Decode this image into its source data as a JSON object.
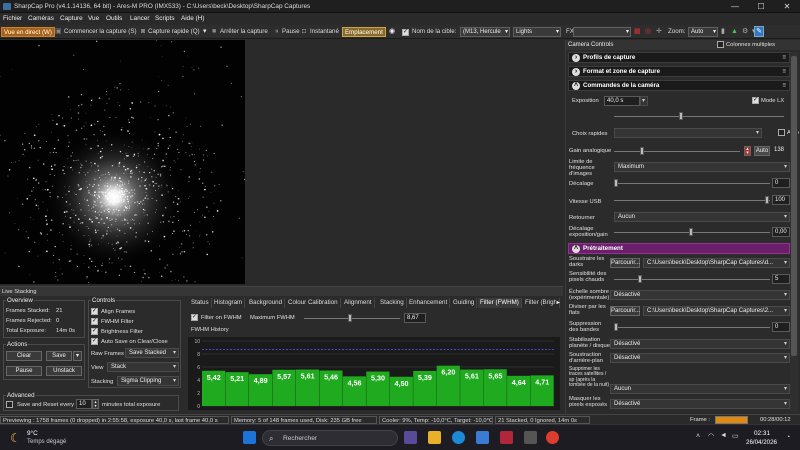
{
  "window": {
    "title": "SharpCap Pro (v4.1.14136, 64 bit) - Ares-M PRO (IMX533) - C:\\Users\\beck\\Desktop\\SharpCap Captures",
    "min": "—",
    "max": "☐",
    "close": "✕"
  },
  "menu": [
    "Fichier",
    "Caméras",
    "Capture",
    "Vue",
    "Outils",
    "Lancer",
    "Scripts",
    "Aide (H)"
  ],
  "toolbar": {
    "live": "Vue en direct (W)",
    "start_capture": "Commencer la capture (S)",
    "quick_capture": "Capture rapide (Q)",
    "stop_capture": "Arrêter la capture",
    "pause": "Pause",
    "snapshot": "Instantané",
    "placement": "Emplacement",
    "target_label": "Nom de la cible:",
    "target_value": "(M13, Hercule",
    "lights": "Lights",
    "fx": "FX",
    "fx_value": "",
    "zoom_label": "Zoom:",
    "zoom_value": "Auto"
  },
  "right": {
    "header": "Camera Controls",
    "multi_col": "Colonnes multiples",
    "sections": {
      "profiles": "Profils de capture",
      "format": "Format et zone de capture",
      "camera": "Commandes de la caméra",
      "preprocess": "Prétraitement"
    },
    "exposure_label": "Exposition",
    "exposure_value": "40,0 s",
    "mode_lx": "Mode LX",
    "quick_choice": "Choix rapides",
    "auto": "Auto",
    "gain_label": "Gain analogique",
    "gain_auto": "Auto",
    "gain_value": "138",
    "limit_label": "Limite de fréquence d'images",
    "limit_value": "Maximum",
    "offset_label": "Décalage",
    "offset_value": "0",
    "usb_label": "Vitesse USB",
    "usb_value": "100",
    "flip_label": "Retourner",
    "flip_value": "Aucun",
    "offset_exp_label": "Décalage exposition/gain",
    "offset_exp_value": "0,00",
    "darks_label": "Soustraire les darks",
    "browse": "Parcourir...",
    "darks_path": "C:\\Users\\beck\\Desktop\\SharpCap Captures\\d...",
    "hot_label": "Sensibilité des pixels chauds",
    "hot_value": "5",
    "dark_scale_label": "Échelle sombre (expérimentale)",
    "dark_scale_value": "Désactivé",
    "flats_label": "Diviser par les flats",
    "flats_path": "C:\\Users\\beck\\Desktop\\SharpCap Captures\\2...",
    "bands_label": "Suppression des bandes",
    "bands_value": "0",
    "stab_label": "Stabilisation planète / disque",
    "stab_value": "Désactivé",
    "bg_label": "Soustraction d'arrière-plan",
    "bg_value": "Désactivé",
    "sat_label": "Supprimer les traces satellites / sp (après la tombée de la nuit)",
    "sat_value": "Aucun",
    "mask_label": "Masquer les pixels exposés",
    "mask_value": "Désactivé"
  },
  "stack": {
    "title": "Live Stacking",
    "overview": "Overview",
    "frames_stacked_label": "Frames Stacked:",
    "frames_stacked": "21",
    "frames_rejected_label": "Frames Rejected:",
    "frames_rejected": "0",
    "total_exp_label": "Total Exposure:",
    "total_exp": "14m 0s",
    "actions": "Actions",
    "clear": "Clear",
    "save": "Save",
    "pause": "Pause",
    "unstack": "Unstack",
    "advanced": "Advanced",
    "save_reset": "Save and Reset every",
    "save_reset_num": "10",
    "save_reset_unit": "minutes total exposure",
    "controls": "Controls",
    "align": "Align Frames",
    "fwhm_filter": "FWHM Filter",
    "brightness": "Brightness Filter",
    "autosave": "Auto Save on Clear/Close",
    "raw_frames": "Raw Frames",
    "raw_value": "Save Stacked",
    "view": "View",
    "view_value": "Stack",
    "stacking": "Stacking",
    "stacking_value": "Sigma Clipping",
    "tabs": [
      "Status",
      "Histogram",
      "Background",
      "Colour Calibration",
      "Alignment",
      "Stacking",
      "Enhancement",
      "Guiding",
      "Filter (FWHM)",
      "Filter (Brigh"
    ],
    "filter_on": "Filter on FWHM",
    "max_fwhm_label": "Maximum FWHM",
    "max_fwhm_value": "8,67",
    "history": "FWHM History"
  },
  "chart_data": {
    "type": "bar",
    "title": "FWHM History",
    "values": [
      5.42,
      5.21,
      4.89,
      5.57,
      5.61,
      5.46,
      4.56,
      5.3,
      4.5,
      5.39,
      6.2,
      5.61,
      5.65,
      4.64,
      4.71
    ],
    "labels": [
      "5,42",
      "5,21",
      "4,89",
      "5,57",
      "5,61",
      "5,46",
      "4,56",
      "5,30",
      "4,50",
      "5,39",
      "6,20",
      "5,61",
      "5,65",
      "4,64",
      "4,71"
    ],
    "threshold": 8.67,
    "yticks": [
      "10",
      "8",
      "6",
      "4",
      "2",
      "0"
    ],
    "ylim": [
      0,
      10
    ],
    "bar_color": "#1faa1f"
  },
  "status": {
    "previewing": "Previewing : 1758 frames (0 dropped) in 2:55:58, exposure 40,0 s, last frame 40,0 s",
    "memory": "Memory: 5 of 148 frames used, Disk: 235 GB free",
    "cooler": "Cooler: 9%, Temp: -10,0°C, Target: -10,0°C",
    "stacked": "21 Stacked, 0 Ignored, 14m 0s",
    "frame": "Frame :",
    "time": "00:28/00:12"
  },
  "taskbar": {
    "temp": "9°C",
    "weather": "Temps dégagé",
    "search": "Rechercher",
    "clock": "02:31",
    "date": "26/04/2026",
    "lang": "FRA"
  }
}
